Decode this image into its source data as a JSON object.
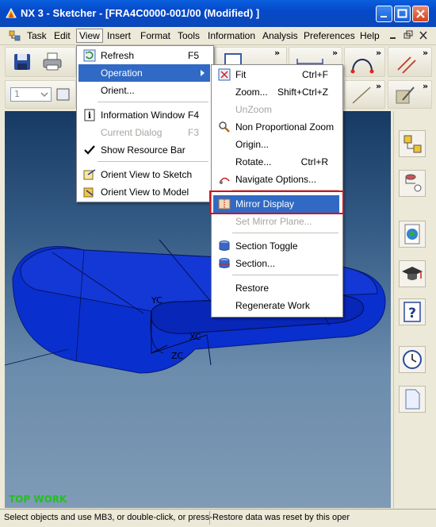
{
  "window": {
    "title": "NX 3 - Sketcher - [FRA4C0000-001/00 (Modified) ]"
  },
  "menubar": {
    "items": [
      "Task",
      "Edit",
      "View",
      "Insert",
      "Format",
      "Tools",
      "Information",
      "Analysis",
      "Preferences",
      "Help"
    ]
  },
  "toolbar": {
    "layer_value": "1"
  },
  "view_menu": {
    "items": [
      {
        "label": "Refresh",
        "shortcut": "F5",
        "icon": "refresh-icon"
      },
      {
        "label": "Operation",
        "shortcut": "",
        "icon": ""
      },
      {
        "label": "Orient...",
        "shortcut": "",
        "icon": ""
      },
      {
        "label": "Information Window",
        "shortcut": "F4",
        "icon": "info-icon"
      },
      {
        "label": "Current Dialog",
        "shortcut": "F3",
        "icon": ""
      },
      {
        "label": "Show Resource Bar",
        "shortcut": "",
        "icon": "check-icon"
      },
      {
        "label": "Orient View to Sketch",
        "shortcut": "",
        "icon": "orient-sketch-icon"
      },
      {
        "label": "Orient View to Model",
        "shortcut": "",
        "icon": "orient-model-icon"
      }
    ]
  },
  "operation_menu": {
    "items": [
      {
        "label": "Fit",
        "shortcut": "Ctrl+F"
      },
      {
        "label": "Zoom...",
        "shortcut": "Shift+Ctrl+Z"
      },
      {
        "label": "UnZoom",
        "shortcut": ""
      },
      {
        "label": "Non Proportional Zoom",
        "shortcut": ""
      },
      {
        "label": "Origin...",
        "shortcut": ""
      },
      {
        "label": "Rotate...",
        "shortcut": "Ctrl+R"
      },
      {
        "label": "Navigate Options...",
        "shortcut": ""
      },
      {
        "label": "Mirror Display",
        "shortcut": ""
      },
      {
        "label": "Set Mirror Plane...",
        "shortcut": ""
      },
      {
        "label": "Section Toggle",
        "shortcut": ""
      },
      {
        "label": "Section...",
        "shortcut": ""
      },
      {
        "label": "Restore",
        "shortcut": ""
      },
      {
        "label": "Regenerate Work",
        "shortcut": ""
      }
    ]
  },
  "viewport": {
    "axis_labels": {
      "yc": "YC",
      "xc": "XC",
      "zc": "ZC"
    },
    "view_name": "TOP WORK",
    "view_name_color": "#21c21b",
    "model_color": "#0a2fcf"
  },
  "status": {
    "left": "Select objects and use MB3, or double-click, or press-",
    "right": "Restore data was reset by this oper"
  },
  "colors": {
    "highlight": "#316ac5",
    "titlebar": "#0549c9",
    "callout": "#d0121b"
  }
}
